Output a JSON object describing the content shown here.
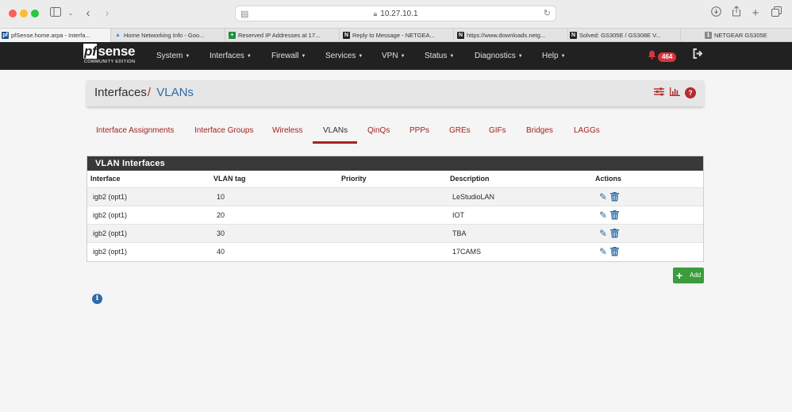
{
  "browser": {
    "url": "10.27.10.1",
    "tabs": [
      {
        "title": "pfSense.home.arpa - Interfa...",
        "favicon": "pf"
      },
      {
        "title": "Home Networking Info - Goo...",
        "favicon": "▲"
      },
      {
        "title": "Reserved IP Addresses at 17...",
        "favicon": "+"
      },
      {
        "title": "Reply to Message - NETGEA...",
        "favicon": "N"
      },
      {
        "title": "https://www.downloads.netg...",
        "favicon": "N"
      },
      {
        "title": "Solved: GS305E / GS308E V...",
        "favicon": "N"
      },
      {
        "title": "NETGEAR GS305E",
        "favicon": "1"
      }
    ]
  },
  "navbar": {
    "logo_main": "sense",
    "logo_pf": "pf",
    "logo_sub": "COMMUNITY EDITION",
    "menu": [
      "System",
      "Interfaces",
      "Firewall",
      "Services",
      "VPN",
      "Status",
      "Diagnostics",
      "Help"
    ],
    "notification_count": "464"
  },
  "breadcrumb": {
    "parent": "Interfaces",
    "separator": "/",
    "current": "VLANs"
  },
  "subtabs": [
    "Interface Assignments",
    "Interface Groups",
    "Wireless",
    "VLANs",
    "QinQs",
    "PPPs",
    "GREs",
    "GIFs",
    "Bridges",
    "LAGGs"
  ],
  "active_subtab": "VLANs",
  "table": {
    "title": "VLAN Interfaces",
    "columns": [
      "Interface",
      "VLAN tag",
      "Priority",
      "Description",
      "Actions"
    ],
    "rows": [
      {
        "interface": "igb2 (opt1)",
        "tag": "10",
        "priority": "",
        "description": "LeStudioLAN"
      },
      {
        "interface": "igb2 (opt1)",
        "tag": "20",
        "priority": "",
        "description": "IOT"
      },
      {
        "interface": "igb2 (opt1)",
        "tag": "30",
        "priority": "",
        "description": "TBA"
      },
      {
        "interface": "igb2 (opt1)",
        "tag": "40",
        "priority": "",
        "description": "17CAMS"
      }
    ]
  },
  "add_button": "Add",
  "icons": {
    "edit": "pencil-icon",
    "delete": "trash-icon",
    "info": "info-icon",
    "settings": "sliders-icon",
    "chart": "bar-chart-icon",
    "help": "help-icon"
  },
  "colors": {
    "accent_red": "#a32222",
    "link_blue": "#2d6aa8",
    "navbar_bg": "#212121",
    "add_green": "#3b9c3b"
  }
}
